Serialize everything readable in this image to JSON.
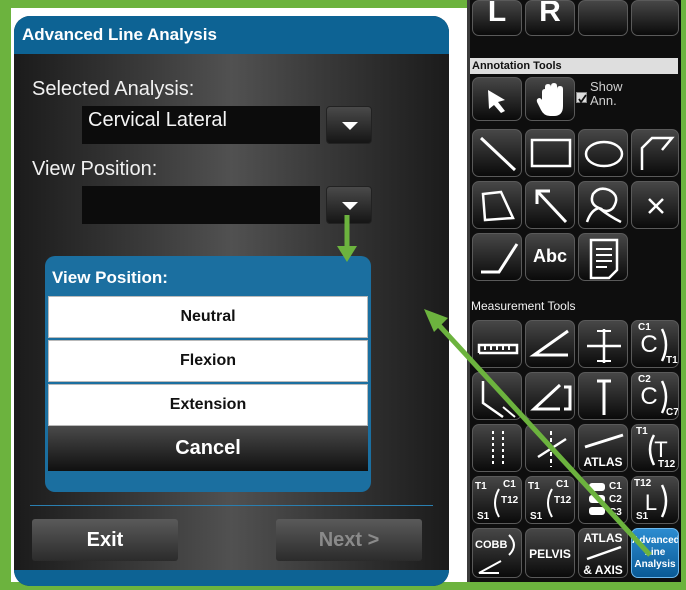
{
  "dialog": {
    "title": "Advanced Line Analysis",
    "selected_analysis_label": "Selected Analysis:",
    "selected_analysis_value": "Cervical Lateral",
    "view_position_label": "View Position:",
    "view_position_value": "",
    "exit_label": "Exit",
    "next_label": "Next >"
  },
  "popup": {
    "title": "View Position:",
    "options": [
      "Neutral",
      "Flexion",
      "Extension"
    ],
    "cancel_label": "Cancel"
  },
  "panel": {
    "top_buttons": [
      "L",
      "R"
    ],
    "annotation_header": "Annotation Tools",
    "show_ann_label": "Show Ann.",
    "show_ann_checked": true,
    "text_tool_label": "Abc",
    "measurement_header": "Measurement Tools",
    "atlas_label": "ATLAS",
    "c1_label": "C1",
    "t1_label": "T1",
    "c2_label": "C2",
    "c7_label": "C7",
    "t12_label": "T12",
    "s1_label": "S1",
    "c3_label": "C3",
    "l_label": "L",
    "cobb_label": "COBB",
    "pelvis_label": "PELVIS",
    "atlas_axis_top": "ATLAS",
    "atlas_axis_bottom": "& AXIS",
    "advanced_line_label_1": "Advanced",
    "advanced_line_label_2": "Line",
    "advanced_line_label_3": "Analysis"
  },
  "colors": {
    "accent_blue": "#0d6394",
    "highlight_green": "#6cb33e",
    "advanced_button_blue": "#2c8cd0"
  }
}
